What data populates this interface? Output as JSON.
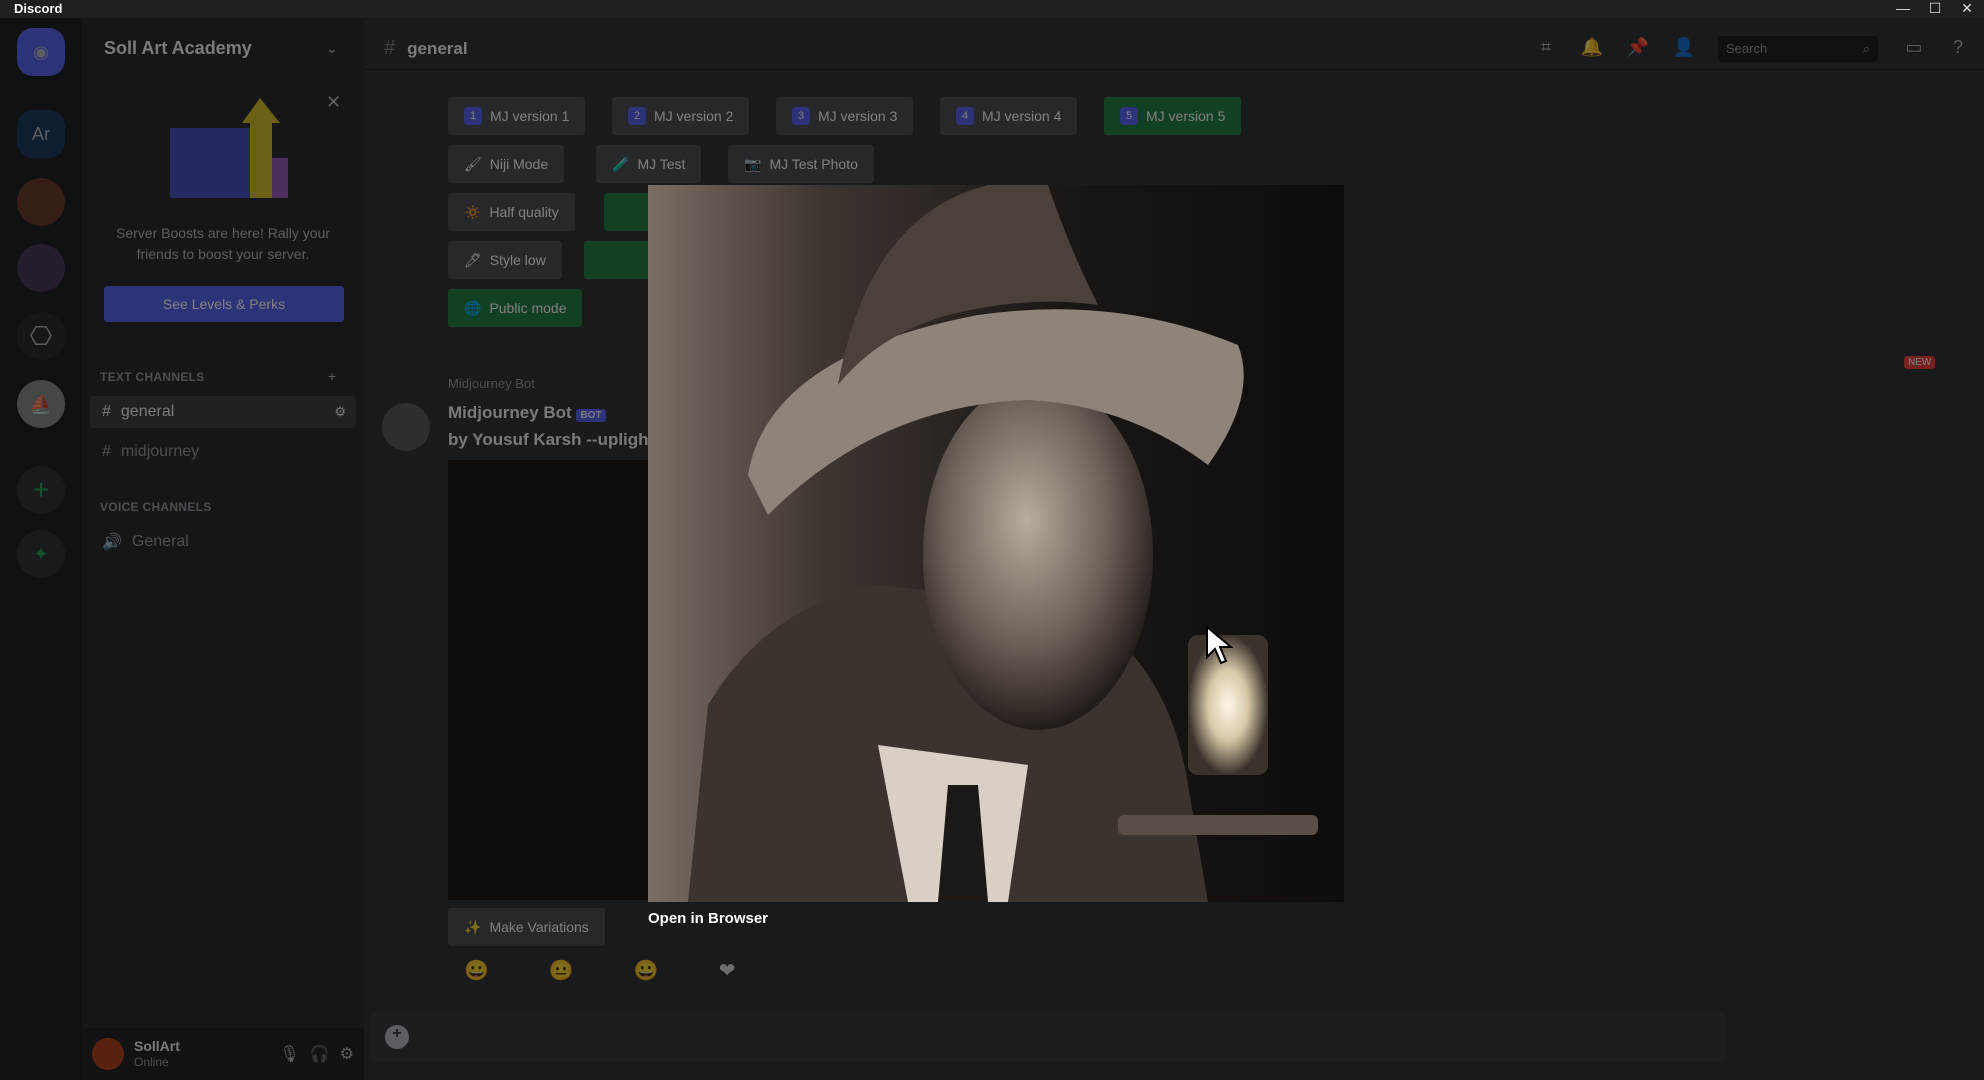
{
  "app": {
    "title": "Discord"
  },
  "window_controls": {
    "minimize": "—",
    "maximize": "☐",
    "close": "✕"
  },
  "servers": [
    {
      "name": "home",
      "label": ""
    },
    {
      "name": "ar",
      "label": "Ar"
    },
    {
      "name": "server-3",
      "label": ""
    },
    {
      "name": "server-4",
      "label": ""
    },
    {
      "name": "openai",
      "label": ""
    },
    {
      "name": "midjourney",
      "label": ""
    },
    {
      "name": "add",
      "label": "+"
    },
    {
      "name": "explore",
      "label": ""
    }
  ],
  "sidebar": {
    "server_name": "Soll Art Academy",
    "boost_text": "Server Boosts are here! Rally your friends to boost your server.",
    "boost_button": "See Levels & Perks",
    "text_category": "Text Channels",
    "channels": [
      {
        "label": "general",
        "active": true
      },
      {
        "label": "midjourney",
        "active": false
      }
    ],
    "voice_category": "Voice Channels",
    "voice_channels": [
      {
        "label": "General"
      }
    ],
    "user": {
      "name": "SollArt",
      "status": "Online"
    }
  },
  "header": {
    "channel": "general",
    "search_placeholder": "Search"
  },
  "buttons": {
    "row1": [
      {
        "num": "1",
        "label": "MJ version 1",
        "active": false
      },
      {
        "num": "2",
        "label": "MJ version 2",
        "active": false
      },
      {
        "num": "3",
        "label": "MJ version 3",
        "active": false
      },
      {
        "num": "4",
        "label": "MJ version 4",
        "active": false
      },
      {
        "num": "5",
        "label": "MJ version 5",
        "active": true
      }
    ],
    "row2": [
      {
        "label": "Niji Mode"
      },
      {
        "label": "MJ Test"
      },
      {
        "label": "MJ Test Photo"
      }
    ],
    "row3": [
      {
        "label": "Half quality"
      }
    ],
    "row4": [
      {
        "label": "Style low"
      }
    ],
    "row5": [
      {
        "label": "Public mode"
      }
    ]
  },
  "message": {
    "reply_line": "Midjourney Bot",
    "author": "Midjourney Bot",
    "bot_tag": "BOT",
    "text": "by Yousuf Karsh --uplight",
    "make_variations": "Make Variations",
    "new_badge": "NEW"
  },
  "viewer": {
    "open_in_browser": "Open in Browser"
  },
  "colors": {
    "blurple": "#5865f2",
    "green": "#248046",
    "bg": "#313338"
  }
}
